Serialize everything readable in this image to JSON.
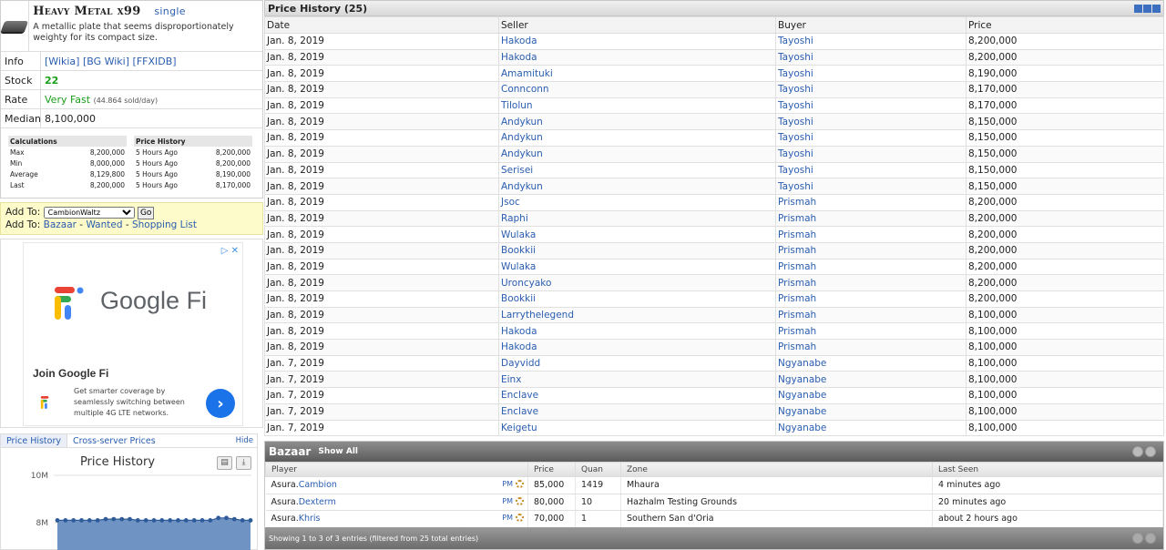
{
  "item": {
    "name": "Heavy Metal",
    "qty": "x99",
    "single_link": "single",
    "description": "A metallic plate that seems disproportionately weighty for its compact size.",
    "info_label": "Info",
    "info_links": [
      "[Wikia]",
      "[BG Wiki]",
      "[FFXIDB]"
    ],
    "stock_label": "Stock",
    "stock": "22",
    "rate_label": "Rate",
    "rate": "Very Fast",
    "rate_sub": "(44.864 sold/day)",
    "median_label": "Median",
    "median": "8,100,000"
  },
  "calc": {
    "title": "Calculations",
    "rows": [
      {
        "k": "Max",
        "v": "8,200,000"
      },
      {
        "k": "Min",
        "v": "8,000,000"
      },
      {
        "k": "Average",
        "v": "8,129,800"
      },
      {
        "k": "Last",
        "v": "8,200,000"
      }
    ]
  },
  "mini_history": {
    "title": "Price History",
    "rows": [
      {
        "k": "5 Hours Ago",
        "v": "8,200,000"
      },
      {
        "k": "5 Hours Ago",
        "v": "8,200,000"
      },
      {
        "k": "5 Hours Ago",
        "v": "8,190,000"
      },
      {
        "k": "5 Hours Ago",
        "v": "8,170,000"
      }
    ]
  },
  "addto": {
    "label": "Add To:",
    "selected": "CambionWaltz",
    "go": "Go",
    "label2": "Add To:",
    "bazaar": "Bazaar",
    "wanted": "Wanted",
    "shopping": "Shopping List",
    "sep": "-"
  },
  "ad": {
    "close": "▷ ✕",
    "brand": "Google Fi",
    "title": "Join Google Fi",
    "body": "Get smarter coverage by seamlessly switching between multiple 4G LTE networks.",
    "arrow": "›"
  },
  "price_chart": {
    "tab1": "Price History",
    "tab2": "Cross-server Prices",
    "hide": "Hide",
    "title": "Price History",
    "print_icon": "printer-icon",
    "download_icon": "download-icon"
  },
  "chart_data": {
    "type": "area",
    "title": "Price History",
    "y_ticks": [
      "10M",
      "8M"
    ],
    "ylim": [
      0,
      10000000
    ],
    "values": [
      8100000,
      8100000,
      8100000,
      8100000,
      8100000,
      8100000,
      8150000,
      8150000,
      8150000,
      8150000,
      8100000,
      8100000,
      8100000,
      8100000,
      8100000,
      8100000,
      8100000,
      8100000,
      8100000,
      8100000,
      8200000,
      8200000,
      8150000,
      8100000,
      8100000
    ]
  },
  "history": {
    "title": "Price History (25)",
    "columns": [
      "Date",
      "Seller",
      "Buyer",
      "Price"
    ],
    "rows": [
      [
        "Jan. 8, 2019",
        "Hakoda",
        "Tayoshi",
        "8,200,000"
      ],
      [
        "Jan. 8, 2019",
        "Hakoda",
        "Tayoshi",
        "8,200,000"
      ],
      [
        "Jan. 8, 2019",
        "Amamituki",
        "Tayoshi",
        "8,190,000"
      ],
      [
        "Jan. 8, 2019",
        "Connconn",
        "Tayoshi",
        "8,170,000"
      ],
      [
        "Jan. 8, 2019",
        "Tilolun",
        "Tayoshi",
        "8,170,000"
      ],
      [
        "Jan. 8, 2019",
        "Andykun",
        "Tayoshi",
        "8,150,000"
      ],
      [
        "Jan. 8, 2019",
        "Andykun",
        "Tayoshi",
        "8,150,000"
      ],
      [
        "Jan. 8, 2019",
        "Andykun",
        "Tayoshi",
        "8,150,000"
      ],
      [
        "Jan. 8, 2019",
        "Serisei",
        "Tayoshi",
        "8,150,000"
      ],
      [
        "Jan. 8, 2019",
        "Andykun",
        "Tayoshi",
        "8,150,000"
      ],
      [
        "Jan. 8, 2019",
        "Jsoc",
        "Prismah",
        "8,200,000"
      ],
      [
        "Jan. 8, 2019",
        "Raphi",
        "Prismah",
        "8,200,000"
      ],
      [
        "Jan. 8, 2019",
        "Wulaka",
        "Prismah",
        "8,200,000"
      ],
      [
        "Jan. 8, 2019",
        "Bookkii",
        "Prismah",
        "8,200,000"
      ],
      [
        "Jan. 8, 2019",
        "Wulaka",
        "Prismah",
        "8,200,000"
      ],
      [
        "Jan. 8, 2019",
        "Uroncyako",
        "Prismah",
        "8,200,000"
      ],
      [
        "Jan. 8, 2019",
        "Bookkii",
        "Prismah",
        "8,200,000"
      ],
      [
        "Jan. 8, 2019",
        "Larrythelegend",
        "Prismah",
        "8,100,000"
      ],
      [
        "Jan. 8, 2019",
        "Hakoda",
        "Prismah",
        "8,100,000"
      ],
      [
        "Jan. 8, 2019",
        "Hakoda",
        "Prismah",
        "8,100,000"
      ],
      [
        "Jan. 7, 2019",
        "Dayvidd",
        "Ngyanabe",
        "8,100,000"
      ],
      [
        "Jan. 7, 2019",
        "Einx",
        "Ngyanabe",
        "8,100,000"
      ],
      [
        "Jan. 7, 2019",
        "Enclave",
        "Ngyanabe",
        "8,100,000"
      ],
      [
        "Jan. 7, 2019",
        "Enclave",
        "Ngyanabe",
        "8,100,000"
      ],
      [
        "Jan. 7, 2019",
        "Keigetu",
        "Ngyanabe",
        "8,100,000"
      ]
    ]
  },
  "bazaar": {
    "title": "Bazaar",
    "show_all": "Show All",
    "columns": [
      "Player",
      "Price",
      "Quan",
      "Zone",
      "Last Seen"
    ],
    "pm": "PM",
    "rows": [
      {
        "server": "Asura.",
        "player": "Cambion",
        "price": "85,000",
        "qty": "1419",
        "zone": "Mhaura",
        "seen": "4 minutes ago"
      },
      {
        "server": "Asura.",
        "player": "Dexterm",
        "price": "80,000",
        "qty": "10",
        "zone": "Hazhalm Testing Grounds",
        "seen": "20 minutes ago"
      },
      {
        "server": "Asura.",
        "player": "Khris",
        "price": "70,000",
        "qty": "1",
        "zone": "Southern San d'Oria",
        "seen": "about 2 hours ago"
      }
    ],
    "footer": "Showing 1 to 3 of 3 entries (filtered from 25 total entries)"
  },
  "colors": {
    "link": "#2a5db0",
    "green": "#1a9e1a",
    "chart_fill": "#6f93c2",
    "chart_line": "#2f5c99"
  }
}
